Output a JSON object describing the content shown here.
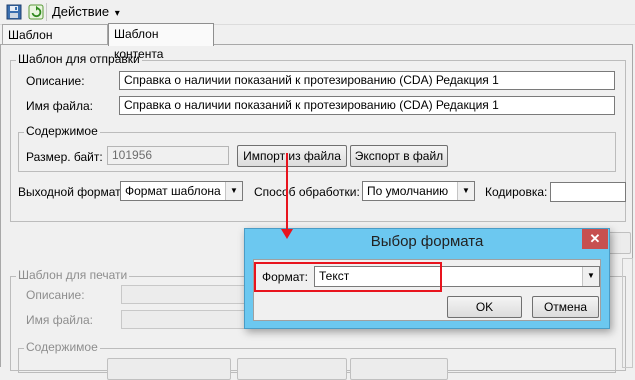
{
  "toolbar": {
    "menu_label": "Действие",
    "menu_arrow": "▾",
    "save_icon": "save-icon",
    "refresh_icon": "refresh-icon"
  },
  "tabs": [
    {
      "label": "Шаблон документа",
      "active": false
    },
    {
      "label": "Шаблон контента",
      "active": true
    }
  ],
  "send_template": {
    "legend": "Шаблон для отправки",
    "description_label": "Описание:",
    "description_value": "Справка о наличии показаний к протезированию (CDA) Редакция 1",
    "filename_label": "Имя файла:",
    "filename_value": "Справка о наличии показаний к протезированию (CDA) Редакция 1",
    "content": {
      "legend": "Содержимое",
      "size_label": "Размер. байт:",
      "size_value": "101956",
      "import_button": "Импорт из файла",
      "export_button": "Экспорт в файл"
    },
    "output_format_label": "Выходной формат:",
    "output_format_value": "Формат шаблона",
    "processing_label": "Способ обработки:",
    "processing_value": "По умолчанию",
    "encoding_label": "Кодировка:",
    "encoding_value": ""
  },
  "print_template": {
    "legend": "Шаблон для печати",
    "description_label": "Описание:",
    "filename_label": "Имя файла:",
    "content_legend": "Содержимое"
  },
  "dialog": {
    "title": "Выбор формата",
    "close_glyph": "✕",
    "format_label": "Формат:",
    "format_value": "Текст",
    "ok_button": "OK",
    "cancel_button": "Отмена"
  },
  "colors": {
    "annotation_red": "#e8141e",
    "dialog_titlebar": "#6cc8f0",
    "close_button": "#c75050"
  }
}
